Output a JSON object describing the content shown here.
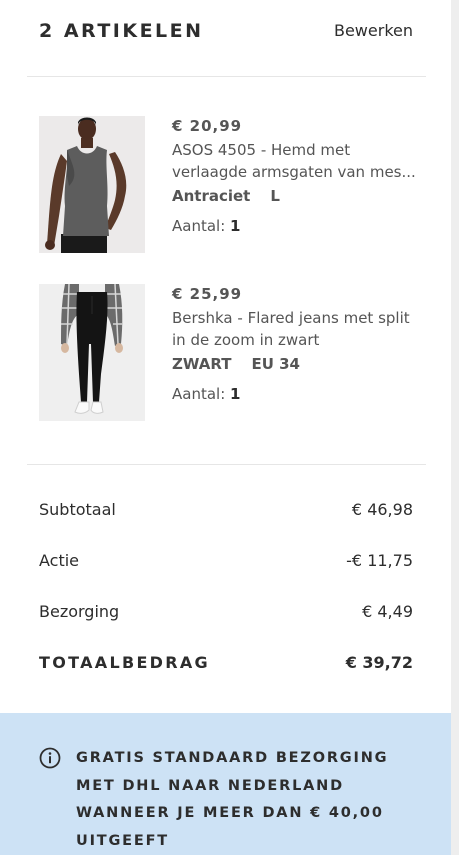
{
  "header": {
    "title": "2 ARTIKELEN",
    "edit_label": "Bewerken"
  },
  "items": [
    {
      "price": "€ 20,99",
      "name_line1": "ASOS 4505 - Hemd met",
      "name_line2": "verlaagde armsgaten van mes...",
      "color": "Antraciet",
      "size": "L",
      "qty_label": "Aantal:",
      "qty": "1",
      "image": "man-in-charcoal-tank-top"
    },
    {
      "price": "€ 25,99",
      "name_line1": "Bershka - Flared jeans met split",
      "name_line2": "in de zoom in zwart",
      "color": "ZWART",
      "size": "EU 34",
      "qty_label": "Aantal:",
      "qty": "1",
      "image": "woman-in-black-flared-jeans"
    }
  ],
  "summary": {
    "subtotal_label": "Subtotaal",
    "subtotal_value": "€ 46,98",
    "discount_label": "Actie",
    "discount_value": "-€ 11,75",
    "shipping_label": "Bezorging",
    "shipping_value": "€ 4,49",
    "total_label": "TOTAALBEDRAG",
    "total_value": "€ 39,72"
  },
  "banner": {
    "icon": "info-icon",
    "line1": "GRATIS STANDAARD BEZORGING",
    "line2": "MET DHL NAAR NEDERLAND",
    "line3": "WANNEER JE MEER DAN € 40,00",
    "line4": "UITGEEFT"
  },
  "colors": {
    "banner_bg": "#cde2f5",
    "text": "#2d2d2d",
    "muted": "#555555"
  }
}
